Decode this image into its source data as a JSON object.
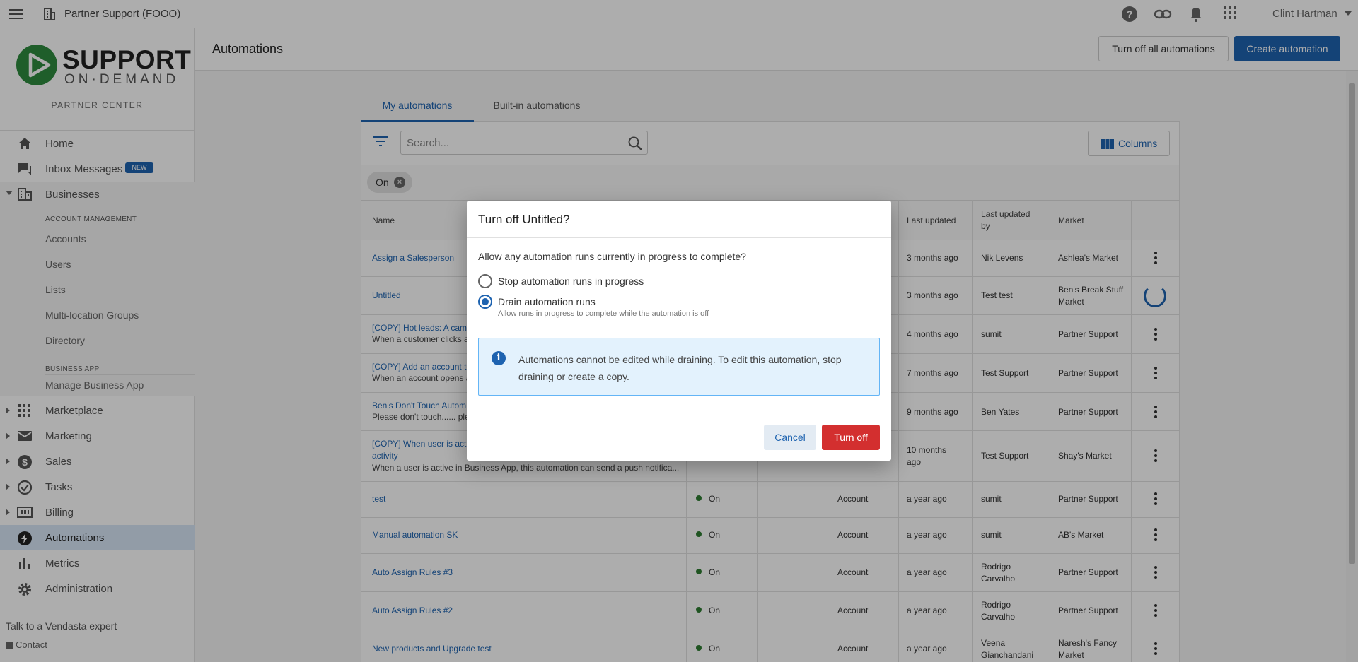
{
  "topbar": {
    "app_title": "Partner Support (FOOO)",
    "user_name": "Clint Hartman",
    "icons": [
      "menu-icon",
      "business-icon",
      "help-icon",
      "link-icon",
      "bell-icon",
      "apps-icon",
      "dropdown-icon"
    ]
  },
  "sidebar": {
    "logo": {
      "brand_top": "SUPPORT",
      "brand_bottom": "ON·DEMAND"
    },
    "partner_center": "PARTNER CENTER",
    "items": [
      {
        "label": "Home",
        "icon": "home-icon"
      },
      {
        "label": "Inbox Messages",
        "icon": "inbox-icon",
        "badge": "NEW"
      },
      {
        "label": "Businesses",
        "icon": "business-icon"
      },
      {
        "label": "Marketplace",
        "icon": "grid-icon"
      },
      {
        "label": "Marketing",
        "icon": "mail-icon"
      },
      {
        "label": "Sales",
        "icon": "dollar-icon"
      },
      {
        "label": "Tasks",
        "icon": "check-circle-icon"
      },
      {
        "label": "Billing",
        "icon": "billing-icon"
      },
      {
        "label": "Automations",
        "icon": "bolt-icon"
      },
      {
        "label": "Metrics",
        "icon": "bar-chart-icon"
      },
      {
        "label": "Administration",
        "icon": "gear-icon"
      }
    ],
    "account_management_label": "ACCOUNT MANAGEMENT",
    "business_app_label": "BUSINESS APP",
    "sub_items": [
      "Accounts",
      "Users",
      "Lists",
      "Multi-location Groups",
      "Directory",
      "Manage Business App"
    ],
    "footer_expert": "Talk to a Vendasta expert",
    "footer_contact": "Contact"
  },
  "header": {
    "title": "Automations",
    "turn_off_all": "Turn off all automations",
    "create": "Create automation"
  },
  "tabs": [
    "My automations",
    "Built-in automations"
  ],
  "toolbar": {
    "search_placeholder": "Search...",
    "columns_label": "Columns",
    "filter_chip": "On"
  },
  "table": {
    "headers": {
      "name": "Name",
      "last_updated": "Last updated",
      "last_updated_by_1": "Last updated",
      "last_updated_by_2": "by",
      "market": "Market"
    },
    "rows": [
      {
        "name": "Assign a Salesperson",
        "desc": "",
        "status": "",
        "type": "",
        "updated": "3 months ago",
        "by": "Nik Levens",
        "market": "Ashlea's Market"
      },
      {
        "name": "Untitled",
        "desc": "",
        "status": "",
        "type": "",
        "updated": "3 months ago",
        "by": "Test test",
        "market": "Ben's Break Stuff Market"
      },
      {
        "name": "[COPY] Hot leads: A camp",
        "desc": "When a customer clicks a",
        "status": "",
        "type": "",
        "updated": "4 months ago",
        "by": "sumit",
        "market": "Partner Support"
      },
      {
        "name": "[COPY] Add an account to",
        "desc": "When an account opens a",
        "status": "",
        "type": "",
        "updated": "7 months ago",
        "by": "Test Support",
        "market": "Partner Support"
      },
      {
        "name": "Ben's Don't Touch Autom",
        "desc": "Please don't touch...... ple",
        "status": "",
        "type": "",
        "updated": "9 months ago",
        "by": "Ben Yates",
        "market": "Partner Support"
      },
      {
        "name": "[COPY] When user is activ",
        "name2": "activity",
        "desc": "When a user is active in Business App, this automation can send a push notifica...",
        "status": "",
        "type": "",
        "updated": "10 months ago",
        "by": "Test Support",
        "market": "Shay's Market"
      },
      {
        "name": "test",
        "desc": "",
        "status": "On",
        "type": "Account",
        "updated": "a year ago",
        "by": "sumit",
        "market": "Partner Support"
      },
      {
        "name": "Manual automation SK",
        "desc": "",
        "status": "On",
        "type": "Account",
        "updated": "a year ago",
        "by": "sumit",
        "market": "AB's Market"
      },
      {
        "name": "Auto Assign Rules #3",
        "desc": "",
        "status": "On",
        "type": "Account",
        "updated": "a year ago",
        "by": "Rodrigo Carvalho",
        "market": "Partner Support"
      },
      {
        "name": "Auto Assign Rules #2",
        "desc": "",
        "status": "On",
        "type": "Account",
        "updated": "a year ago",
        "by": "Rodrigo Carvalho",
        "market": "Partner Support"
      },
      {
        "name": "New products and Upgrade test",
        "desc": "",
        "status": "On",
        "type": "Account",
        "updated": "a year ago",
        "by": "Veena Gianchandani",
        "market": "Naresh's Fancy Market"
      }
    ]
  },
  "dialog": {
    "title": "Turn off Untitled?",
    "question": "Allow any automation runs currently in progress to complete?",
    "option_stop": "Stop automation runs in progress",
    "option_drain": "Drain automation runs",
    "option_drain_hint": "Allow runs in progress to complete while the automation is off",
    "selected": "Drain automation runs",
    "info": "Automations cannot be edited while draining. To edit this automation, stop draining or create a copy.",
    "cancel": "Cancel",
    "confirm": "Turn off"
  },
  "colors": {
    "primary": "#1e63b0",
    "danger": "#d32f2f",
    "status_on": "#2e7d32",
    "info_bg": "#e3f2fd"
  }
}
